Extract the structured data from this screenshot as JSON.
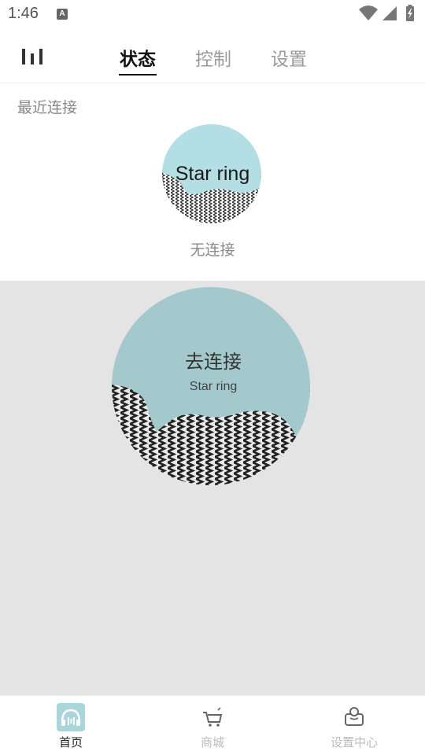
{
  "status_bar": {
    "time": "1:46",
    "notification_icon": "A"
  },
  "header": {
    "tabs": [
      {
        "label": "状态",
        "active": true
      },
      {
        "label": "控制",
        "active": false
      },
      {
        "label": "设置",
        "active": false
      }
    ]
  },
  "recent": {
    "title": "最近连接",
    "device_name": "Star ring",
    "connection_status": "无连接"
  },
  "connect_panel": {
    "title": "去连接",
    "device_name": "Star ring"
  },
  "bottom_nav": {
    "items": [
      {
        "label": "首页",
        "icon": "headphones-icon",
        "active": true
      },
      {
        "label": "商城",
        "icon": "cart-icon",
        "active": false
      },
      {
        "label": "设置中心",
        "icon": "user-center-icon",
        "active": false
      }
    ]
  },
  "colors": {
    "ring_teal": "#b3dfe4",
    "ring_teal_dark": "#a4c9cd",
    "main_bg": "#e4e4e4",
    "active_tab": "#111111",
    "inactive_tab": "#9a9a9a",
    "nav_active_bg": "#a9d6db"
  }
}
